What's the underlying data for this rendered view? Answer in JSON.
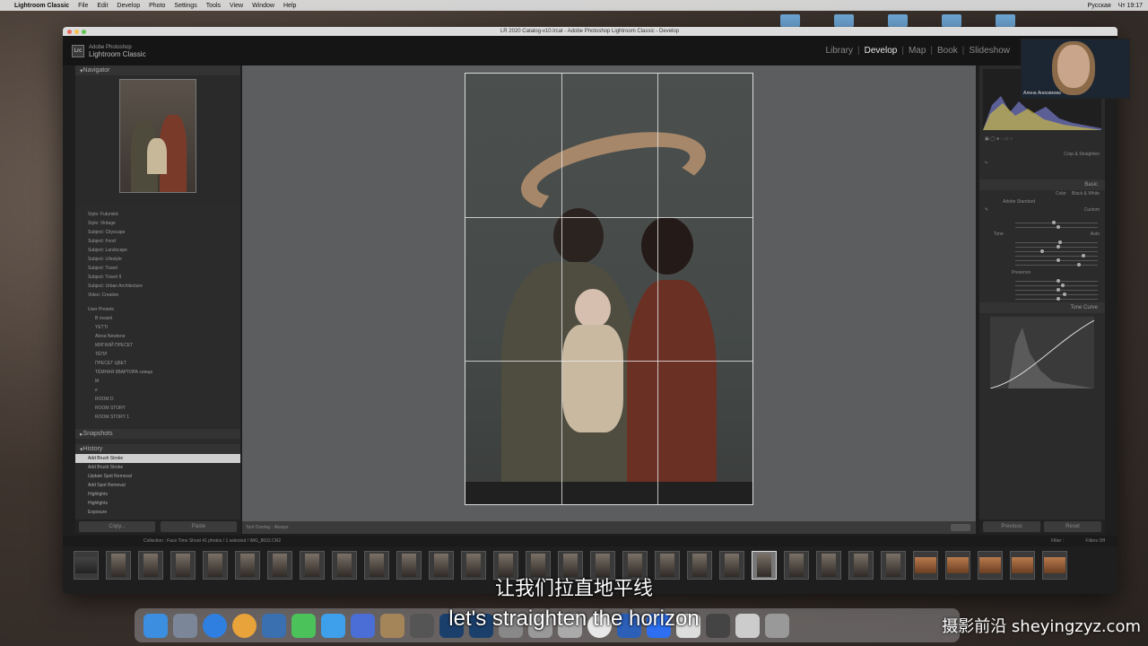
{
  "menubar": {
    "app_name": "Lightroom Classic",
    "items": [
      "File",
      "Edit",
      "Develop",
      "Photo",
      "Settings",
      "Tools",
      "View",
      "Window",
      "Help"
    ],
    "status_right": [
      "Русская",
      "Чт 19:17"
    ]
  },
  "window": {
    "title": "LR 2020 Catalog-v10.lrcat - Adobe Photoshop Lightroom Classic - Develop",
    "brand_small": "Adobe Photoshop",
    "brand_big": "Lightroom Classic",
    "logo": "Lrc"
  },
  "modules": [
    "Library",
    "Develop",
    "Map",
    "Book",
    "Slideshow"
  ],
  "active_module": "Develop",
  "left_panel": {
    "navigator_label": "Navigator",
    "presets": [
      "Style: Futuristic",
      "Style: Vintage",
      "Subject: Cityscape",
      "Subject: Food",
      "Subject: Landscape",
      "Subject: Lifestyle",
      "Subject: Travel",
      "Subject: Travel II",
      "Subject: Urban Architecture",
      "Video: Creative"
    ],
    "user_presets_label": "User Presets",
    "user_presets": [
      "B rossiel",
      "YETTI",
      "Alexa Newtone",
      "МЯГКИЙ ПРЕСЕТ",
      "ТЁПЛ",
      "ПРЕСЕТ ЦВЕТ",
      "ТЁМНАЯ КВАРТИРА сияще",
      "М",
      "e",
      "ROOM D",
      "ROOM STORY",
      "ROOM STORY 1"
    ],
    "snapshots_label": "Snapshots",
    "history_label": "History",
    "history": [
      "Add Brush Stroke",
      "Add Brush Stroke",
      "Update Spot Removal",
      "Add Spot Removal",
      "Highlights",
      "Highlights",
      "Exposure"
    ],
    "copy_label": "Copy...",
    "paste_label": "Paste"
  },
  "right_panel": {
    "crop_label": "Crop & Straighten",
    "basic_label": "Basic",
    "treatment": [
      "Color",
      "Black & White"
    ],
    "profile": "Adobe Standard",
    "wb": "Custom",
    "tone_label": "Tone",
    "tone_auto": "Auto",
    "presence_label": "Presence",
    "tone_curve_label": "Tone Curve",
    "previous_label": "Previous",
    "reset_label": "Reset"
  },
  "toolbar": {
    "tool_overlay": "Tool Overlay :",
    "tool_overlay_value": "Always",
    "done_label": "Done"
  },
  "filmstrip": {
    "info": "Collection : Face Time Shoot   41 photos / 1 selected / IMG_8632.CR2",
    "filter_label": "Filter :",
    "filter_value": "Filters Off"
  },
  "webcam": {
    "label": "Алена Анисимова"
  },
  "subtitles": {
    "chinese": "让我们拉直地平线",
    "english": "let's straighten the horizon"
  },
  "watermark": "摄影前沿 sheyingzyz.com"
}
